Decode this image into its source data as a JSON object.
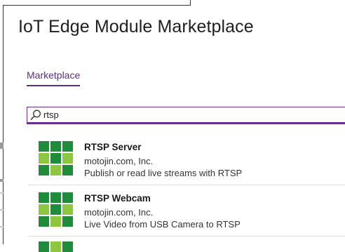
{
  "page": {
    "title": "IoT Edge Module Marketplace"
  },
  "tabs": [
    {
      "label": "Marketplace"
    }
  ],
  "search": {
    "value": "rtsp"
  },
  "colors": {
    "accent": "#5b2d85",
    "tile_dark": "#1e8c3a",
    "tile_light": "#8dc63f"
  },
  "results": [
    {
      "icon": "green-grid-logo",
      "title": "RTSP Server",
      "publisher": "motojin.com, Inc.",
      "description": "Publish or read live streams with RTSP"
    },
    {
      "icon": "green-grid-logo",
      "title": "RTSP Webcam",
      "publisher": "motojin.com, Inc.",
      "description": "Live Video from USB Camera to RTSP"
    }
  ]
}
